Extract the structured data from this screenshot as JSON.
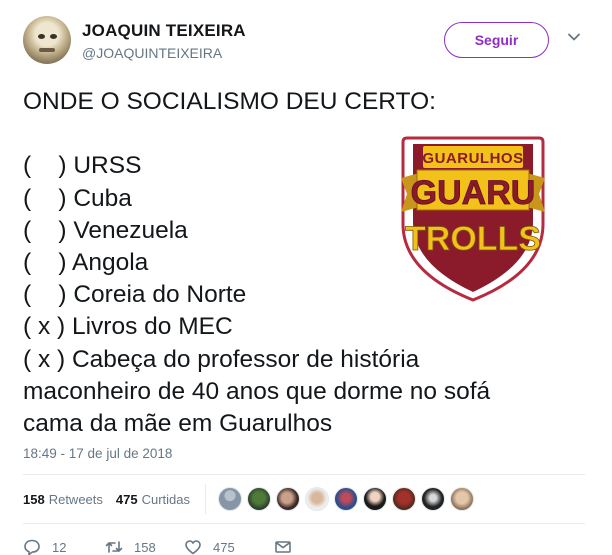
{
  "user": {
    "name": "JOAQUIN TEIXEIRA",
    "handle": "@JOAQUINTEIXEIRA",
    "follow_label": "Seguir"
  },
  "tweet": {
    "text": "ONDE O SOCIALISMO DEU CERTO:\n\n(    ) URSS\n(    ) Cuba\n(    ) Venezuela\n(    ) Angola\n(    ) Coreia do Norte\n( x ) Livros do MEC\n( x ) Cabeça do professor de história maconheiro de 40 anos que dorme no sofá cama da mãe em Guarulhos",
    "timestamp": "18:49 - 17 de jul de 2018"
  },
  "logo": {
    "top_text": "GUARULHOS",
    "middle_text": "GUARU",
    "bottom_text": "TROLLS",
    "colors": {
      "shield": "#8b1a2a",
      "gold": "#f2c21b",
      "outline": "#ffffff"
    }
  },
  "stats": {
    "retweets_count": "158",
    "retweets_label": "Retweets",
    "likes_count": "475",
    "likes_label": "Curtidas"
  },
  "actions": {
    "replies": "12",
    "retweets": "158",
    "likes": "475"
  },
  "theme": {
    "accent": "#8e2dc8",
    "muted": "#657786"
  }
}
